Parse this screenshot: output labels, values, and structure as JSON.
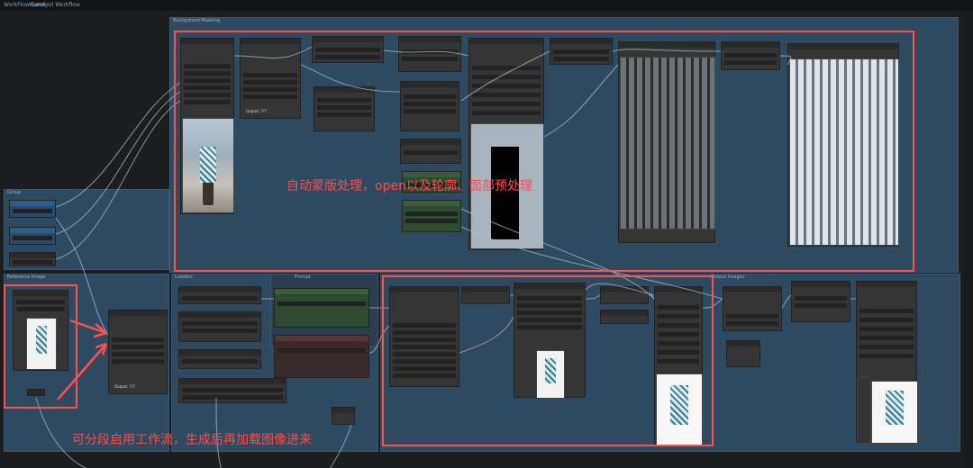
{
  "header": {
    "crumb1": "WorkFlowName",
    "crumb2": "ComfyUI Workflow"
  },
  "groups": {
    "background": "Background Masking",
    "group": "Group",
    "reference": "Reference Image",
    "loaders": "Loaders",
    "prompt": "Prompt",
    "output": "Output Images"
  },
  "node_outputs": {
    "top_output": "Output: ???",
    "ref_output": "Output: ???"
  },
  "annotations": {
    "top": "自动蒙版处理，open以及轮廓、面部预处理",
    "bottom": "可分段启用工作流，生成后再加载图像进来"
  },
  "colors": {
    "accent": "#ff5050",
    "group": "#2e4a60"
  }
}
